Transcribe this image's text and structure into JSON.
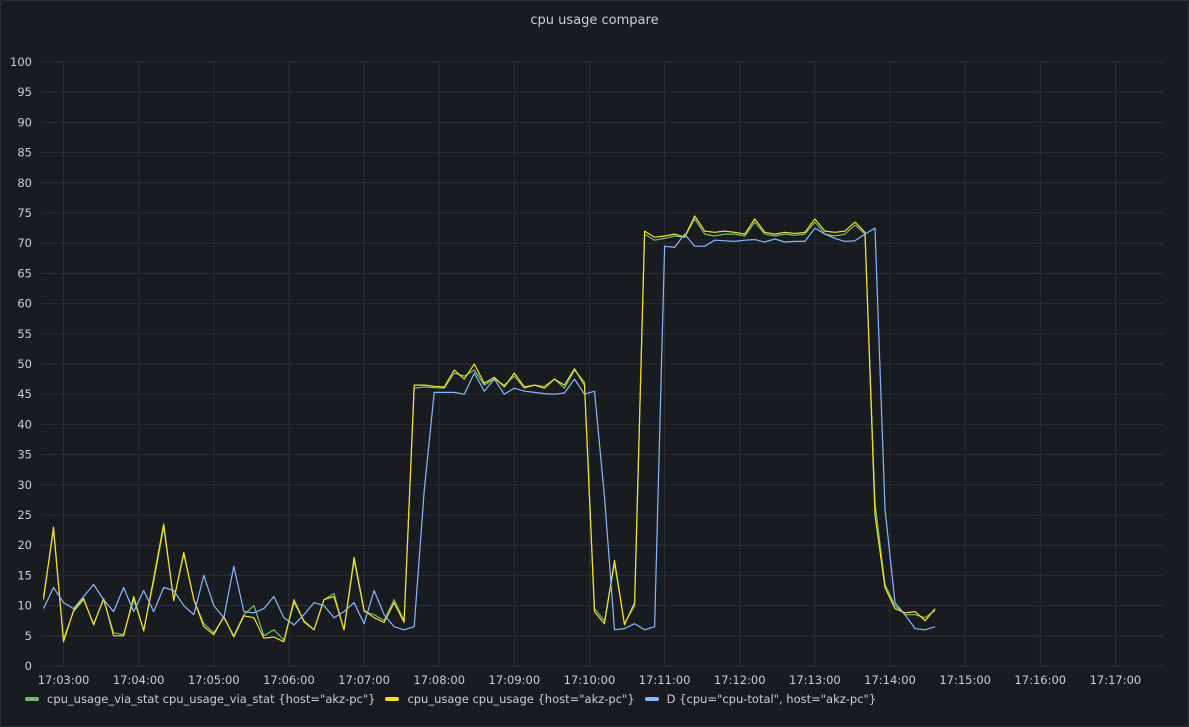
{
  "panel": {
    "title": "cpu usage compare"
  },
  "chart_data": {
    "type": "line",
    "title": "cpu usage compare",
    "xlabel": "",
    "ylabel": "",
    "ylim": [
      0,
      100
    ],
    "yticks": [
      0,
      5,
      10,
      15,
      20,
      25,
      30,
      35,
      40,
      45,
      50,
      55,
      60,
      65,
      70,
      75,
      80,
      85,
      90,
      95,
      100
    ],
    "xlim": [
      "17:02:42",
      "17:17:38"
    ],
    "xticks": [
      "17:03:00",
      "17:04:00",
      "17:05:00",
      "17:06:00",
      "17:07:00",
      "17:08:00",
      "17:09:00",
      "17:10:00",
      "17:11:00",
      "17:12:00",
      "17:13:00",
      "17:14:00",
      "17:15:00",
      "17:16:00",
      "17:17:00"
    ],
    "grid": true,
    "legend": "bottom-left",
    "x_start": "17:02:44",
    "x_step_seconds": 8,
    "series": [
      {
        "name": "cpu_usage_via_stat cpu_usage_via_stat {host=\"akz-pc\"}",
        "color": "#73bf69",
        "values": [
          11.5,
          22.5,
          4.5,
          9,
          11,
          7,
          11,
          5.5,
          5.2,
          11,
          6,
          14,
          23,
          11,
          18.5,
          11,
          7,
          5.5,
          8,
          5,
          8.5,
          10,
          5,
          6,
          4.3,
          10.5,
          7.5,
          6,
          11,
          12,
          6,
          17.5,
          9,
          8.5,
          7.5,
          11,
          7.5,
          46,
          46.2,
          46.1,
          46,
          48.5,
          48,
          49,
          46.5,
          47.5,
          46.5,
          48,
          46,
          46.5,
          46.3,
          47.5,
          46,
          49,
          47,
          9.5,
          7.5,
          17,
          7,
          10,
          71.5,
          70.5,
          70.8,
          71.2,
          71,
          74,
          71.5,
          71.2,
          71.5,
          71.5,
          71.2,
          73.5,
          71.5,
          71.2,
          71.5,
          71.3,
          71.5,
          73.5,
          71.5,
          71.2,
          71.5,
          73,
          71.5,
          27,
          13.5,
          10,
          8.5,
          8.5,
          8,
          9.2
        ]
      },
      {
        "name": "cpu_usage cpu_usage {host=\"akz-pc\"}",
        "color": "#fade2a",
        "values": [
          11,
          23,
          4,
          9.2,
          11.2,
          6.8,
          11.2,
          5,
          5,
          11.5,
          5.8,
          14.5,
          23.5,
          10.8,
          18.8,
          11,
          6.5,
          5.2,
          8.2,
          4.8,
          8.3,
          8,
          4.6,
          4.8,
          4,
          11,
          7.3,
          6,
          11,
          11.5,
          6,
          18,
          9.2,
          8,
          7.2,
          10.5,
          7.2,
          46.5,
          46.5,
          46.3,
          46.2,
          49,
          47.5,
          50,
          46.8,
          47.8,
          46.2,
          48.5,
          46.2,
          46.5,
          46,
          47.5,
          46.5,
          49.2,
          46.5,
          9,
          7,
          17.5,
          6.8,
          10.5,
          72,
          71,
          71.2,
          71.5,
          71,
          74.5,
          72,
          71.8,
          72,
          71.8,
          71.5,
          74,
          71.8,
          71.5,
          71.8,
          71.6,
          71.8,
          74,
          72,
          71.8,
          72,
          73.5,
          71.8,
          25,
          13,
          9.5,
          8.8,
          9,
          7.5,
          9.5
        ]
      },
      {
        "name": "D {cpu=\"cpu-total\", host=\"akz-pc\"}",
        "color": "#8ab8ff",
        "values": [
          9.5,
          13,
          10.5,
          9.5,
          11.5,
          13.5,
          11,
          9,
          13,
          9,
          12.5,
          9,
          13,
          12.5,
          10,
          8.5,
          15,
          10,
          8,
          16.5,
          9,
          8.8,
          9.5,
          11.5,
          8,
          6.8,
          8.5,
          10.5,
          10,
          8,
          9,
          10.5,
          7,
          12.5,
          8.5,
          6.5,
          6,
          6.5,
          29,
          45.3,
          45.3,
          45.3,
          45,
          48.5,
          45.5,
          47.5,
          45,
          46,
          45.5,
          45.3,
          45.1,
          45,
          45.2,
          47.5,
          45,
          45.5,
          28,
          6,
          6.2,
          7,
          6,
          6.5,
          69.5,
          69.3,
          71.5,
          69.5,
          69.5,
          70.5,
          70.4,
          70.3,
          70.5,
          70.6,
          70.2,
          70.7,
          70.2,
          70.3,
          70.3,
          72.5,
          71.5,
          70.8,
          70.3,
          70.4,
          71.5,
          72.5,
          26,
          10.5,
          8.5,
          6.2,
          6,
          6.5
        ]
      }
    ]
  }
}
